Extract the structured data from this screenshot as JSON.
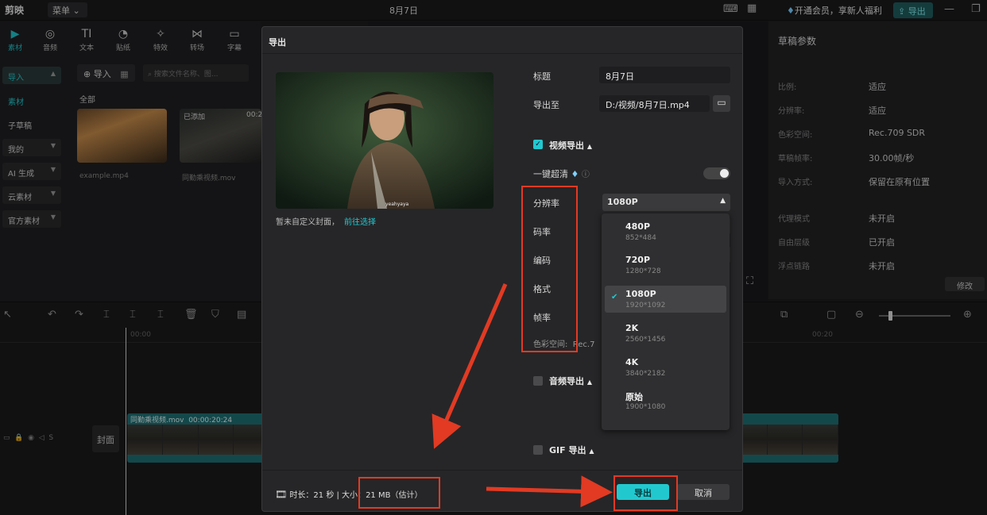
{
  "app": {
    "logo": "剪映",
    "menu_label": "菜单",
    "title": "8月7日",
    "vip_text": "开通会员，享新人福利",
    "export_top": "导出"
  },
  "toolbar": {
    "tools": [
      {
        "label": "素材",
        "icon": "media-icon"
      },
      {
        "label": "音频",
        "icon": "audio-icon"
      },
      {
        "label": "文本",
        "icon": "text-icon"
      },
      {
        "label": "贴纸",
        "icon": "sticker-icon"
      },
      {
        "label": "特效",
        "icon": "effects-icon"
      },
      {
        "label": "转场",
        "icon": "transition-icon"
      },
      {
        "label": "字幕",
        "icon": "subtitle-icon"
      }
    ]
  },
  "sidebar": {
    "items": [
      {
        "label": "导入"
      },
      {
        "label": "素材"
      },
      {
        "label": "子草稿"
      },
      {
        "label": "我的"
      },
      {
        "label": "AI 生成"
      },
      {
        "label": "云素材"
      },
      {
        "label": "官方素材"
      }
    ]
  },
  "media": {
    "import_label": "导入",
    "search_placeholder": "搜索文件名称、图...",
    "all_label": "全部",
    "files": [
      {
        "name": "example.mp4",
        "badge": ""
      },
      {
        "name": "同勤乘视频.mov",
        "badge": "已添加",
        "duration": "00:2"
      }
    ]
  },
  "draft_params": {
    "title": "草稿参数",
    "rows": [
      {
        "k": "比例:",
        "v": "适应"
      },
      {
        "k": "分辨率:",
        "v": "适应"
      },
      {
        "k": "色彩空间:",
        "v": "Rec.709 SDR"
      },
      {
        "k": "草稿帧率:",
        "v": "30.00帧/秒"
      },
      {
        "k": "导入方式:",
        "v": "保留在原有位置"
      },
      {
        "k": "代理模式",
        "v": "未开启"
      },
      {
        "k": "自由层级",
        "v": "已开启"
      },
      {
        "k": "浮点链路",
        "v": "未开启"
      }
    ],
    "edit_label": "修改"
  },
  "timeline": {
    "time_start": "00:00",
    "time_mid": "00:20",
    "clip_name": "同勤乘视频.mov",
    "clip_duration": "00:00:20:24",
    "cover_label": "封面"
  },
  "modal": {
    "title": "导出",
    "cover_note": "暂未自定义封面，",
    "cover_link": "前往选择",
    "fields": {
      "title_label": "标题",
      "title_value": "8月7日",
      "path_label": "导出至",
      "path_value": "D:/视频/8月7日.mp4"
    },
    "video_export": {
      "label": "视频导出",
      "enhance_label": "一键超清",
      "rows": [
        "分辨率",
        "码率",
        "编码",
        "格式",
        "帧率"
      ],
      "color_space": "色彩空间:",
      "color_space_value": "Rec.7",
      "resolution_value": "1080P",
      "resolution_options": [
        {
          "name": "480P",
          "dims": "852*484"
        },
        {
          "name": "720P",
          "dims": "1280*728"
        },
        {
          "name": "1080P",
          "dims": "1920*1092",
          "selected": true
        },
        {
          "name": "2K",
          "dims": "2560*1456"
        },
        {
          "name": "4K",
          "dims": "3840*2182"
        },
        {
          "name": "原始",
          "dims": "1900*1080"
        }
      ]
    },
    "audio_export_label": "音频导出",
    "gif_export_label": "GIF 导出",
    "footer": {
      "duration_text": "时长：21 秒 | 大小：",
      "size_text": "21 MB（估计）"
    },
    "export_button": "导出",
    "cancel_button": "取消"
  },
  "colors": {
    "accent": "#21c9cf",
    "annotation_red": "#e23a23"
  }
}
